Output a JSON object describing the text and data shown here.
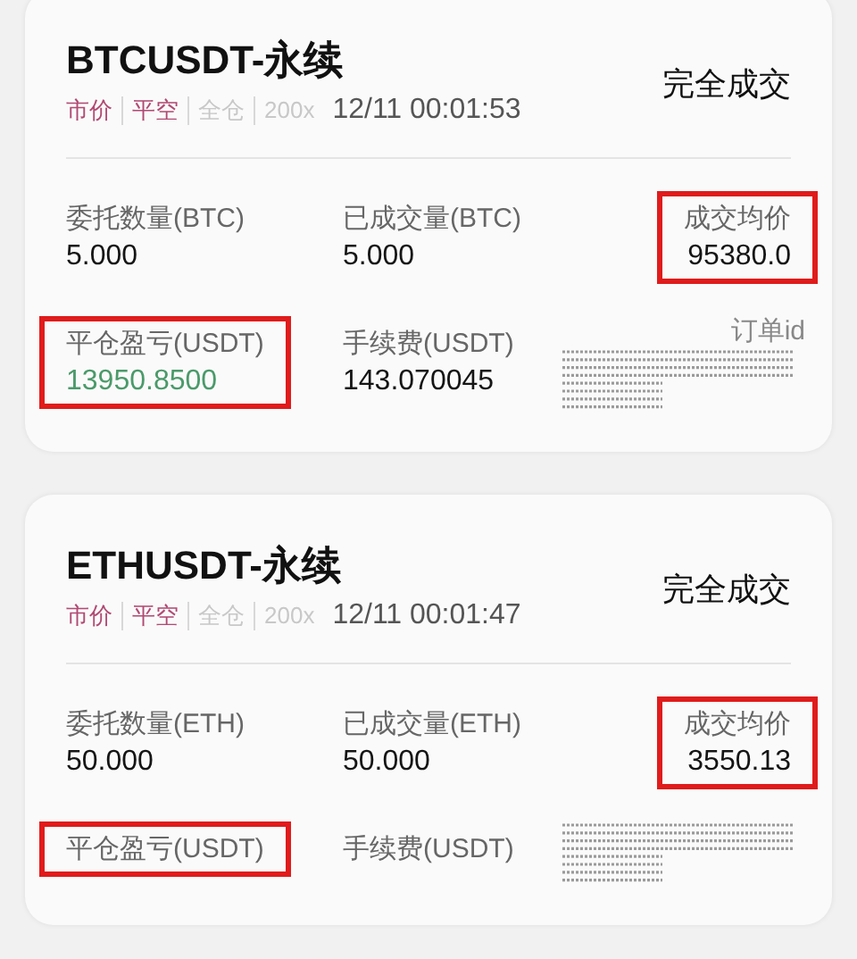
{
  "orders": [
    {
      "title": "BTCUSDT-永续",
      "status": "完全成交",
      "tags": [
        {
          "label": "市价",
          "active": true
        },
        {
          "label": "平空",
          "active": true
        },
        {
          "label": "全仓",
          "active": false
        },
        {
          "label": "200x",
          "active": false
        }
      ],
      "time": "12/11 00:01:53",
      "fields": [
        {
          "label": "委托数量(BTC)",
          "value": "5.000",
          "kind": "plain",
          "highlighted": false
        },
        {
          "label": "已成交量(BTC)",
          "value": "5.000",
          "kind": "plain",
          "highlighted": false
        },
        {
          "label": "成交均价",
          "value": "95380.0",
          "kind": "plain",
          "highlighted": true
        },
        {
          "label": "平仓盈亏(USDT)",
          "value": "13950.8500",
          "kind": "profit",
          "highlighted": true
        },
        {
          "label": "手续费(USDT)",
          "value": "143.070045",
          "kind": "plain",
          "highlighted": false
        }
      ],
      "order_id_label": "订单id"
    },
    {
      "title": "ETHUSDT-永续",
      "status": "完全成交",
      "tags": [
        {
          "label": "市价",
          "active": true
        },
        {
          "label": "平空",
          "active": true
        },
        {
          "label": "全仓",
          "active": false
        },
        {
          "label": "200x",
          "active": false
        }
      ],
      "time": "12/11 00:01:47",
      "fields": [
        {
          "label": "委托数量(ETH)",
          "value": "50.000",
          "kind": "plain",
          "highlighted": false
        },
        {
          "label": "已成交量(ETH)",
          "value": "50.000",
          "kind": "plain",
          "highlighted": false
        },
        {
          "label": "成交均价",
          "value": "3550.13",
          "kind": "plain",
          "highlighted": true
        },
        {
          "label": "平仓盈亏(USDT)",
          "highlighted": true
        },
        {
          "label": "手续费(USDT)",
          "highlighted": false
        }
      ]
    }
  ]
}
